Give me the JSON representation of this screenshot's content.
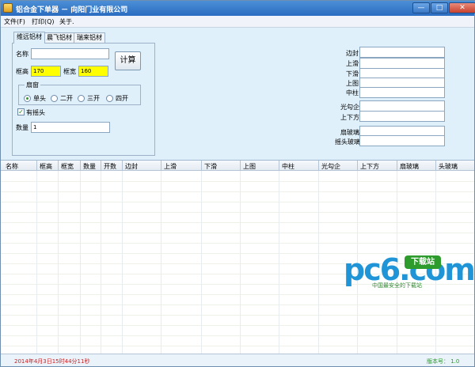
{
  "window": {
    "title": "铝合金下单器 － 向阳门业有限公司"
  },
  "controls": {
    "minimize": "0",
    "maximize": "1",
    "close": "r"
  },
  "menu": {
    "items": [
      "文件(F)",
      "打印(Q)",
      "关于."
    ]
  },
  "tabs": [
    "维远铝材",
    "晨飞铝材",
    "瑞来铝材"
  ],
  "form": {
    "name_label": "名称",
    "name_value": "",
    "frame_height_label": "框高",
    "frame_height_value": "170",
    "frame_width_label": "框宽",
    "frame_width_value": "160",
    "calc_button": "计算",
    "sash_group": "扇窗",
    "sash_options": [
      "单头",
      "二开",
      "三开",
      "四开"
    ],
    "sash_selected": "单头",
    "swing_head_label": "有摇头",
    "swing_head_checked": true,
    "quantity_label": "数量",
    "quantity_value": "1"
  },
  "right_fields": [
    "边封",
    "上滑",
    "下滑",
    "上图",
    "中柱",
    "光勾企",
    "上下方",
    "扇玻璃",
    "摇头玻璃"
  ],
  "table": {
    "columns": [
      "名称",
      "框高",
      "框宽",
      "数量",
      "开数",
      "边封",
      "上滑",
      "下滑",
      "上图",
      "中柱",
      "光勾企",
      "上下方",
      "扇玻璃",
      "头玻璃"
    ]
  },
  "watermark": {
    "brand": "pc6",
    "suffix": ".com",
    "badge": "下载站",
    "tagline": "中国最安全的下载站"
  },
  "status": {
    "datetime": "2014年4月3日15时44分11秒",
    "version": "版本号： 1.0"
  },
  "colors": {
    "title_bar": "#2a6cc0",
    "yellow_input": "#ffff00",
    "status_time": "#d02020",
    "status_version": "#2a9a2a"
  }
}
